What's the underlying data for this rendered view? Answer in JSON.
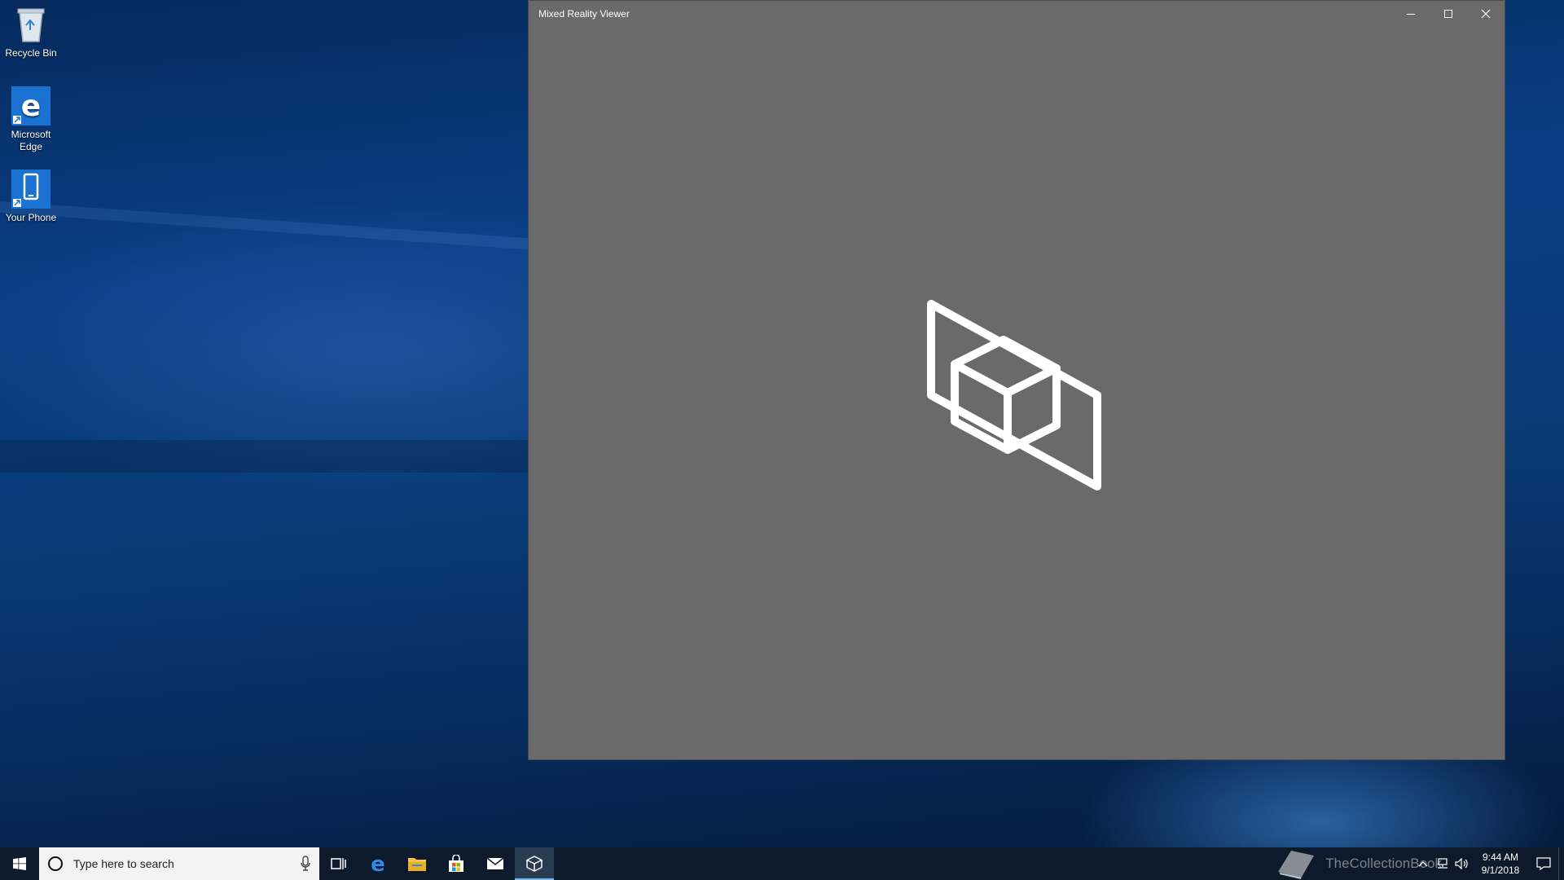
{
  "desktop": {
    "icons": [
      {
        "label": "Recycle Bin",
        "icon": "recycle-bin-icon"
      },
      {
        "label": "Microsoft Edge",
        "icon": "edge-icon"
      },
      {
        "label": "Your Phone",
        "icon": "phone-icon"
      }
    ]
  },
  "window": {
    "title": "Mixed Reality Viewer",
    "minimize_icon": "minimize-icon",
    "maximize_icon": "maximize-icon",
    "close_icon": "close-icon",
    "logo_icon": "mixed-reality-viewer-logo-icon"
  },
  "taskbar": {
    "search_placeholder": "Type here to search",
    "pinned": [
      "task-view-icon",
      "edge-icon",
      "file-explorer-icon",
      "store-icon",
      "mail-icon",
      "mixed-reality-viewer-icon"
    ],
    "watermark": "TheCollectionBook",
    "time": "9:44 AM",
    "date": "9/1/2018"
  },
  "colors": {
    "window_bg": "#6a6a6a",
    "taskbar_bg": "#0d1a2b",
    "accent": "#0078d7"
  }
}
